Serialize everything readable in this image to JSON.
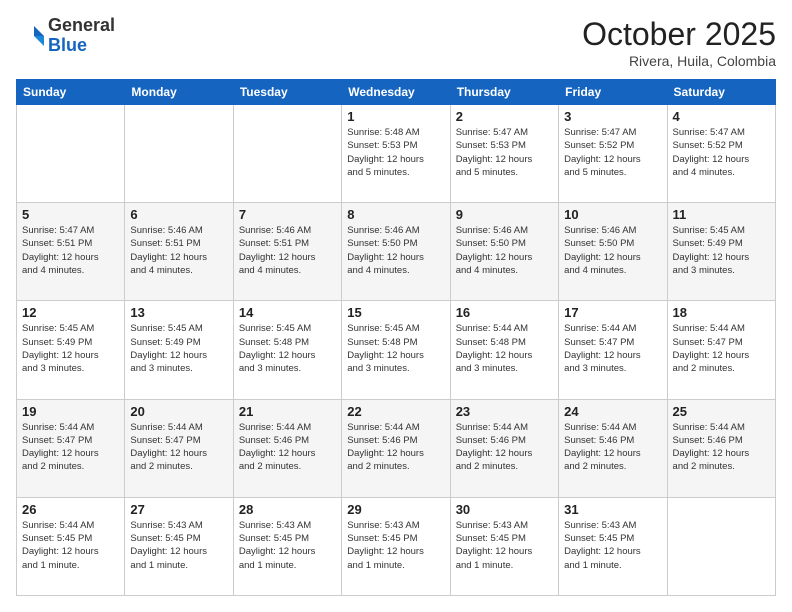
{
  "header": {
    "logo_general": "General",
    "logo_blue": "Blue",
    "month": "October 2025",
    "location": "Rivera, Huila, Colombia"
  },
  "weekdays": [
    "Sunday",
    "Monday",
    "Tuesday",
    "Wednesday",
    "Thursday",
    "Friday",
    "Saturday"
  ],
  "weeks": [
    [
      {
        "day": "",
        "info": ""
      },
      {
        "day": "",
        "info": ""
      },
      {
        "day": "",
        "info": ""
      },
      {
        "day": "1",
        "info": "Sunrise: 5:48 AM\nSunset: 5:53 PM\nDaylight: 12 hours\nand 5 minutes."
      },
      {
        "day": "2",
        "info": "Sunrise: 5:47 AM\nSunset: 5:53 PM\nDaylight: 12 hours\nand 5 minutes."
      },
      {
        "day": "3",
        "info": "Sunrise: 5:47 AM\nSunset: 5:52 PM\nDaylight: 12 hours\nand 5 minutes."
      },
      {
        "day": "4",
        "info": "Sunrise: 5:47 AM\nSunset: 5:52 PM\nDaylight: 12 hours\nand 4 minutes."
      }
    ],
    [
      {
        "day": "5",
        "info": "Sunrise: 5:47 AM\nSunset: 5:51 PM\nDaylight: 12 hours\nand 4 minutes."
      },
      {
        "day": "6",
        "info": "Sunrise: 5:46 AM\nSunset: 5:51 PM\nDaylight: 12 hours\nand 4 minutes."
      },
      {
        "day": "7",
        "info": "Sunrise: 5:46 AM\nSunset: 5:51 PM\nDaylight: 12 hours\nand 4 minutes."
      },
      {
        "day": "8",
        "info": "Sunrise: 5:46 AM\nSunset: 5:50 PM\nDaylight: 12 hours\nand 4 minutes."
      },
      {
        "day": "9",
        "info": "Sunrise: 5:46 AM\nSunset: 5:50 PM\nDaylight: 12 hours\nand 4 minutes."
      },
      {
        "day": "10",
        "info": "Sunrise: 5:46 AM\nSunset: 5:50 PM\nDaylight: 12 hours\nand 4 minutes."
      },
      {
        "day": "11",
        "info": "Sunrise: 5:45 AM\nSunset: 5:49 PM\nDaylight: 12 hours\nand 3 minutes."
      }
    ],
    [
      {
        "day": "12",
        "info": "Sunrise: 5:45 AM\nSunset: 5:49 PM\nDaylight: 12 hours\nand 3 minutes."
      },
      {
        "day": "13",
        "info": "Sunrise: 5:45 AM\nSunset: 5:49 PM\nDaylight: 12 hours\nand 3 minutes."
      },
      {
        "day": "14",
        "info": "Sunrise: 5:45 AM\nSunset: 5:48 PM\nDaylight: 12 hours\nand 3 minutes."
      },
      {
        "day": "15",
        "info": "Sunrise: 5:45 AM\nSunset: 5:48 PM\nDaylight: 12 hours\nand 3 minutes."
      },
      {
        "day": "16",
        "info": "Sunrise: 5:44 AM\nSunset: 5:48 PM\nDaylight: 12 hours\nand 3 minutes."
      },
      {
        "day": "17",
        "info": "Sunrise: 5:44 AM\nSunset: 5:47 PM\nDaylight: 12 hours\nand 3 minutes."
      },
      {
        "day": "18",
        "info": "Sunrise: 5:44 AM\nSunset: 5:47 PM\nDaylight: 12 hours\nand 2 minutes."
      }
    ],
    [
      {
        "day": "19",
        "info": "Sunrise: 5:44 AM\nSunset: 5:47 PM\nDaylight: 12 hours\nand 2 minutes."
      },
      {
        "day": "20",
        "info": "Sunrise: 5:44 AM\nSunset: 5:47 PM\nDaylight: 12 hours\nand 2 minutes."
      },
      {
        "day": "21",
        "info": "Sunrise: 5:44 AM\nSunset: 5:46 PM\nDaylight: 12 hours\nand 2 minutes."
      },
      {
        "day": "22",
        "info": "Sunrise: 5:44 AM\nSunset: 5:46 PM\nDaylight: 12 hours\nand 2 minutes."
      },
      {
        "day": "23",
        "info": "Sunrise: 5:44 AM\nSunset: 5:46 PM\nDaylight: 12 hours\nand 2 minutes."
      },
      {
        "day": "24",
        "info": "Sunrise: 5:44 AM\nSunset: 5:46 PM\nDaylight: 12 hours\nand 2 minutes."
      },
      {
        "day": "25",
        "info": "Sunrise: 5:44 AM\nSunset: 5:46 PM\nDaylight: 12 hours\nand 2 minutes."
      }
    ],
    [
      {
        "day": "26",
        "info": "Sunrise: 5:44 AM\nSunset: 5:45 PM\nDaylight: 12 hours\nand 1 minute."
      },
      {
        "day": "27",
        "info": "Sunrise: 5:43 AM\nSunset: 5:45 PM\nDaylight: 12 hours\nand 1 minute."
      },
      {
        "day": "28",
        "info": "Sunrise: 5:43 AM\nSunset: 5:45 PM\nDaylight: 12 hours\nand 1 minute."
      },
      {
        "day": "29",
        "info": "Sunrise: 5:43 AM\nSunset: 5:45 PM\nDaylight: 12 hours\nand 1 minute."
      },
      {
        "day": "30",
        "info": "Sunrise: 5:43 AM\nSunset: 5:45 PM\nDaylight: 12 hours\nand 1 minute."
      },
      {
        "day": "31",
        "info": "Sunrise: 5:43 AM\nSunset: 5:45 PM\nDaylight: 12 hours\nand 1 minute."
      },
      {
        "day": "",
        "info": ""
      }
    ]
  ]
}
